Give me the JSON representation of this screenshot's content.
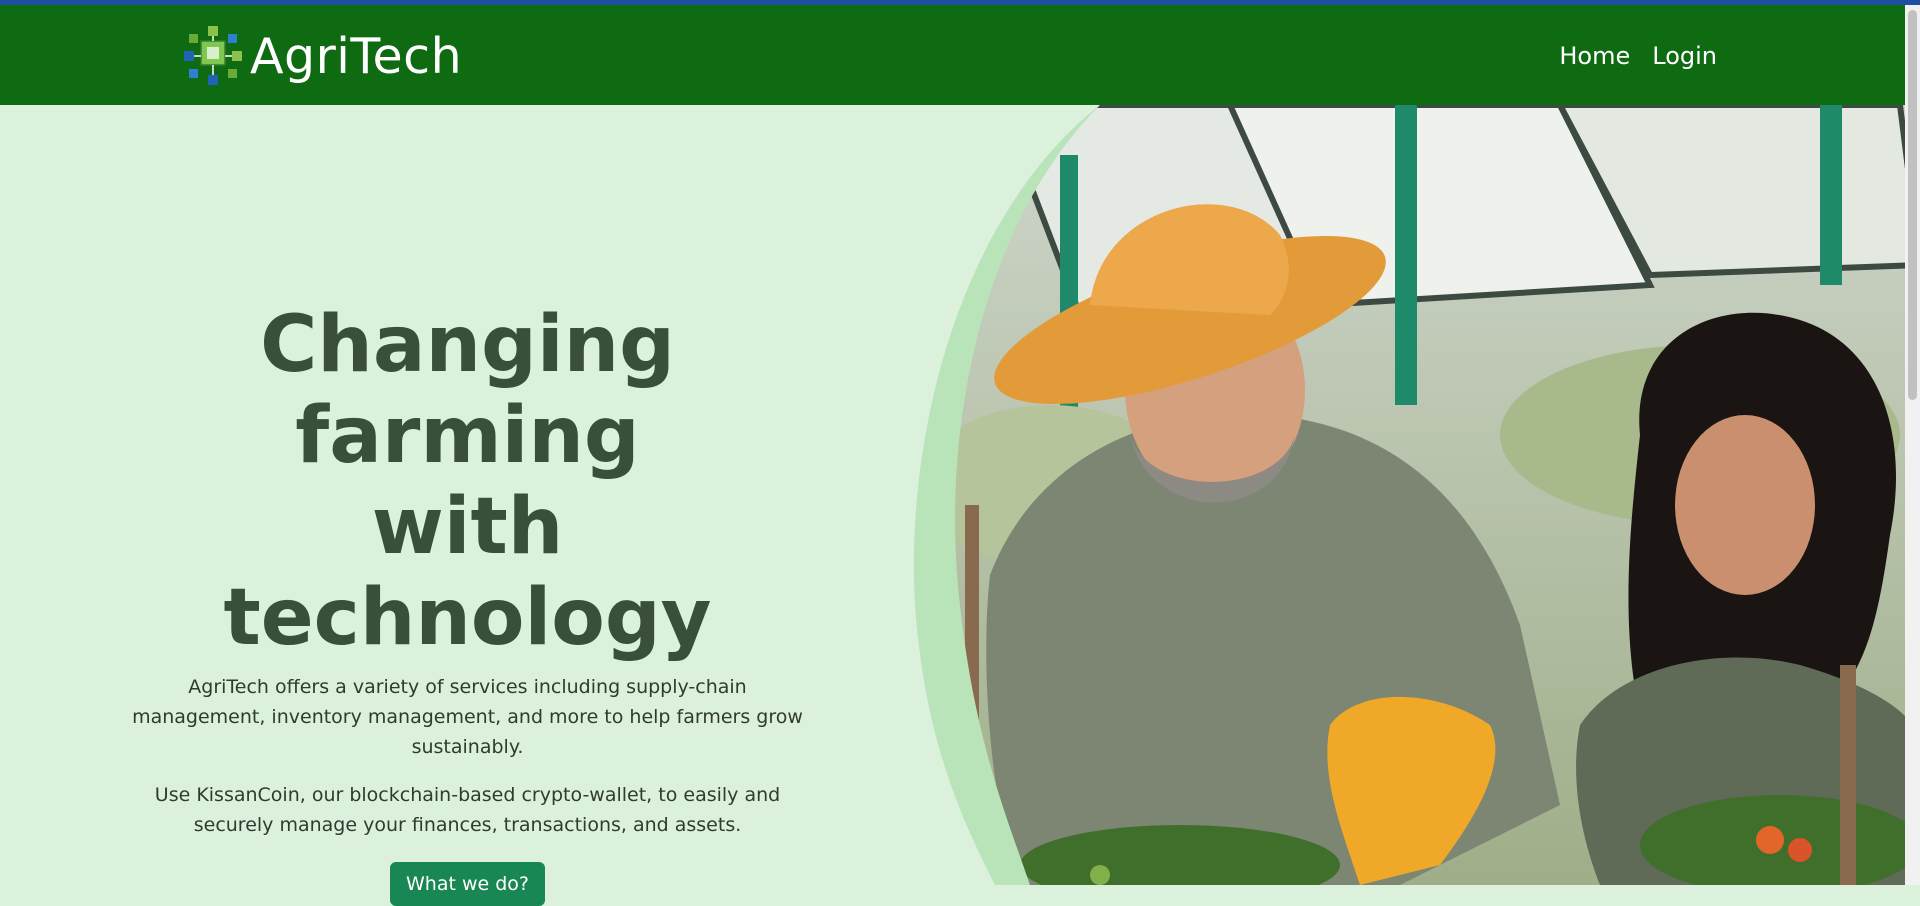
{
  "brand": {
    "name": "AgriTech",
    "logo_icon": "blockchain-cube-logo-icon"
  },
  "nav": {
    "home_label": "Home",
    "login_label": "Login"
  },
  "hero": {
    "title_line1": "Changing farming",
    "title_line2": "with technology",
    "paragraph1": "AgriTech offers a variety of services including supply-chain management, inventory management, and more to help farmers grow sustainably.",
    "paragraph2": "Use KissanCoin, our blockchain-based crypto-wallet, to easily and securely manage your finances, transactions, and assets.",
    "cta_label": "What we do?",
    "image_alt": "Two farmers smiling while tending tomato plants under solar panels"
  },
  "colors": {
    "navbar": "#0f6b12",
    "hero_background": "#dcf1dc",
    "title": "#3a4f3a",
    "cta": "#198754",
    "top_strip": "#1f4fa0"
  }
}
